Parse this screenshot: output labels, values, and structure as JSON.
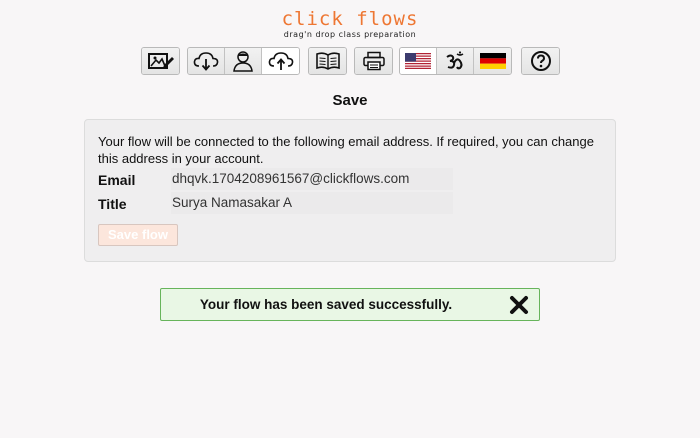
{
  "app": {
    "logo_title": "click flows",
    "logo_tagline": "drag'n drop class preparation"
  },
  "toolbar": {
    "groups": [
      {
        "buttons": [
          {
            "icon": "edit-image-icon"
          }
        ]
      },
      {
        "buttons": [
          {
            "icon": "cloud-download-icon"
          },
          {
            "icon": "user-icon"
          },
          {
            "icon": "cloud-upload-icon",
            "active": true
          }
        ]
      },
      {
        "buttons": [
          {
            "icon": "book-icon"
          }
        ]
      },
      {
        "buttons": [
          {
            "icon": "print-icon"
          }
        ]
      },
      {
        "buttons": [
          {
            "icon": "us-flag-icon",
            "active": true
          },
          {
            "icon": "om-icon"
          },
          {
            "icon": "german-flag-icon"
          }
        ]
      },
      {
        "buttons": [
          {
            "icon": "help-icon"
          }
        ]
      }
    ]
  },
  "page": {
    "title": "Save"
  },
  "form": {
    "info": "Your flow will be connected to the following email address. If required, you can change this address in your account.",
    "email_label": "Email",
    "email_value": "dhqvk.1704208961567@clickflows.com",
    "title_label": "Title",
    "title_value": "Surya Namasakar A",
    "save_label": "Save flow"
  },
  "toast": {
    "message": "Your flow has been saved successfully."
  },
  "colors": {
    "logo": "#ee7733",
    "success_bg": "#e9f7e5",
    "success_border": "#67b45b",
    "save_button_bg": "#fce6dc"
  }
}
